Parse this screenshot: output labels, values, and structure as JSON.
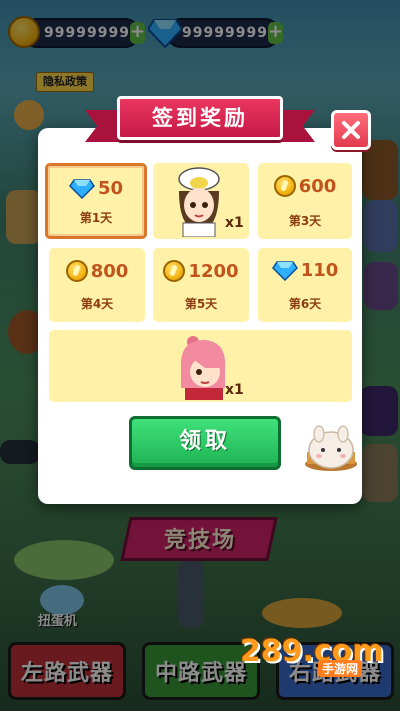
{
  "hud": {
    "coins_value": "99999999",
    "gems_value": "99999999",
    "plus_symbol": "+",
    "privacy_label": "隐私政策"
  },
  "background": {
    "arena_label": "竞技场",
    "machine_label": "扭蛋机",
    "left_weapon": "左路武器",
    "mid_weapon": "中路武器",
    "right_weapon": "右路武器",
    "watermark": "289.com",
    "watermark_sub": "手游网"
  },
  "modal": {
    "title": "签到奖励",
    "claim_label": "领取",
    "days": [
      {
        "reward": "gem",
        "amount": "50",
        "day": "第1天",
        "selected": true
      },
      {
        "reward": "character",
        "amount": "x1",
        "day": ""
      },
      {
        "reward": "coin",
        "amount": "600",
        "day": "第3天"
      },
      {
        "reward": "coin",
        "amount": "800",
        "day": "第4天"
      },
      {
        "reward": "coin",
        "amount": "1200",
        "day": "第5天"
      },
      {
        "reward": "gem",
        "amount": "110",
        "day": "第6天"
      },
      {
        "reward": "character",
        "amount": "x1",
        "day": ""
      }
    ]
  },
  "colors": {
    "ribbon": "#d8234e",
    "cell_bg": "#fff2a8",
    "claim_green": "#2ccb66",
    "close_red": "#ea4458",
    "amount_text": "#c1541c"
  }
}
